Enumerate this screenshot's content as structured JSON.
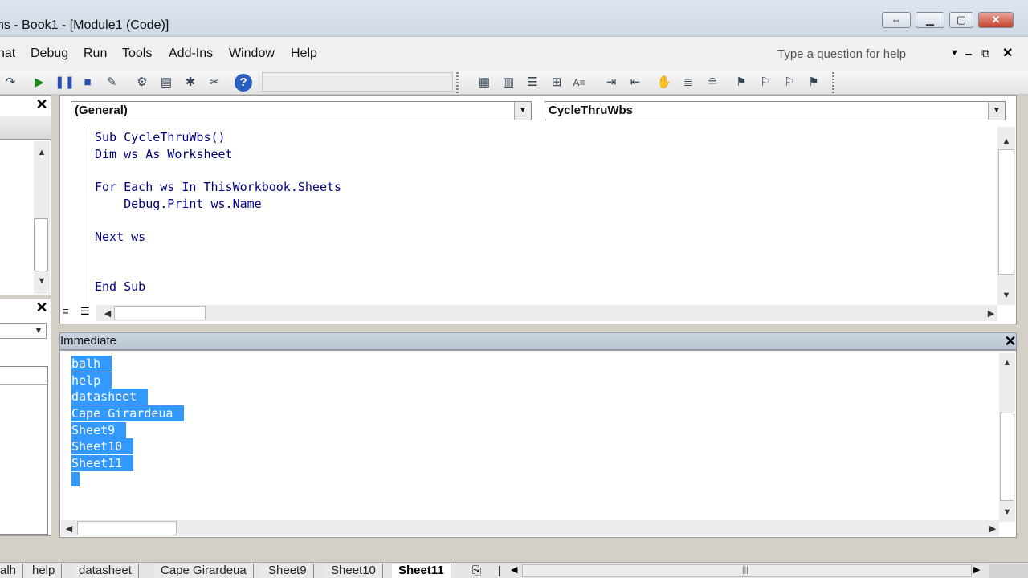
{
  "window": {
    "title": "ns - Book1 - [Module1 (Code)]",
    "restore_icon": "restore-arrows-icon",
    "minimize_label": "▭",
    "close_label": "✕"
  },
  "menu": {
    "items": [
      "nat",
      "Debug",
      "Run",
      "Tools",
      "Add-Ins",
      "Window",
      "Help"
    ],
    "help_search_placeholder": "Type a question for help"
  },
  "code": {
    "object_dropdown": "(General)",
    "procedure_dropdown": "CycleThruWbs",
    "lines": [
      "Sub CycleThruWbs()",
      "Dim ws As Worksheet",
      "",
      "For Each ws In ThisWorkbook.Sheets",
      "    Debug.Print ws.Name",
      "",
      "Next ws",
      "",
      "",
      "End Sub"
    ]
  },
  "immediate": {
    "title": "Immediate",
    "lines": [
      "balh",
      "help",
      "datasheet",
      "Cape Girardeua",
      "Sheet9",
      "Sheet10",
      "Sheet11"
    ]
  },
  "sheet_tabs": {
    "tabs": [
      "alh",
      "help",
      "datasheet",
      "Cape Girardeua",
      "Sheet9",
      "Sheet10",
      "Sheet11"
    ],
    "active": "Sheet11"
  },
  "colors": {
    "selection": "#3399ff",
    "code_text": "#00007f"
  }
}
